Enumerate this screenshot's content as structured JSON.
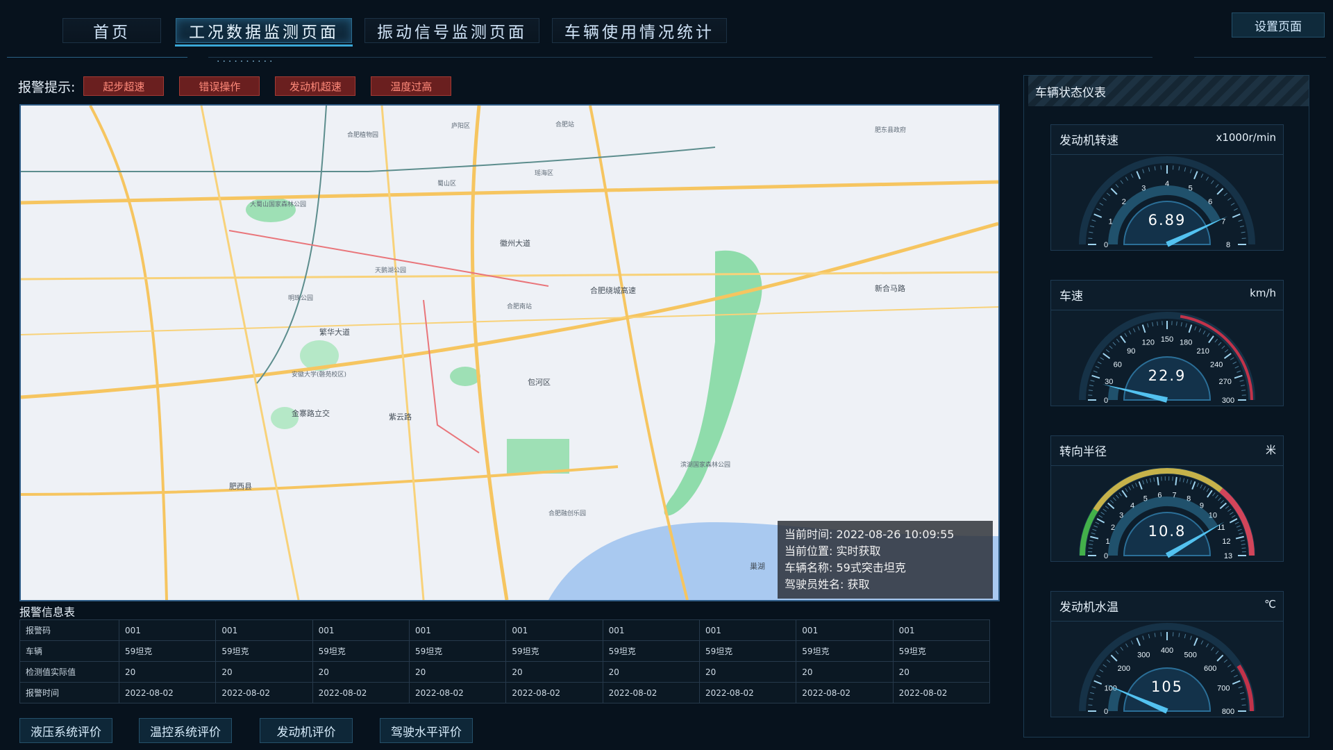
{
  "nav": {
    "tabs": [
      "首页",
      "工况数据监测页面",
      "振动信号监测页面",
      "车辆使用情况统计"
    ],
    "active_index": 1,
    "settings_label": "设置页面"
  },
  "alarm": {
    "label": "报警提示:",
    "tags": [
      "起步超速",
      "错误操作",
      "发动机超速",
      "温度过高"
    ]
  },
  "map": {
    "labels": [
      {
        "text": "庐阳区"
      },
      {
        "text": "瑶海区"
      },
      {
        "text": "蜀山区"
      },
      {
        "text": "繁华大道"
      },
      {
        "text": "金寨路立交"
      },
      {
        "text": "紫云路"
      },
      {
        "text": "合肥绕城高速"
      },
      {
        "text": "徽州大道"
      },
      {
        "text": "新合马路"
      },
      {
        "text": "肥西县"
      },
      {
        "text": "肥东县政府"
      },
      {
        "text": "合肥南站"
      },
      {
        "text": "安徽大学(磬苑校区)"
      },
      {
        "text": "大蜀山国家森林公园"
      },
      {
        "text": "合肥植物园"
      },
      {
        "text": "天鹅湖公园"
      },
      {
        "text": "明珠公园"
      },
      {
        "text": "合肥站"
      },
      {
        "text": "滨湖国家森林公园"
      },
      {
        "text": "合肥融创乐园"
      },
      {
        "text": "包河区"
      },
      {
        "text": "巢湖"
      }
    ],
    "info": {
      "time_label": "当前时间:",
      "time_value": "2022-08-26 10:09:55",
      "location_label": "当前位置:",
      "location_value": "实时获取",
      "vehicle_label": "车辆名称:",
      "vehicle_value": "59式突击坦克",
      "driver_label": "驾驶员姓名:",
      "driver_value": "获取"
    }
  },
  "table": {
    "title": "报警信息表",
    "rows": [
      {
        "header": "报警码",
        "cells": [
          "001",
          "001",
          "001",
          "001",
          "001",
          "001",
          "001",
          "001",
          "001"
        ]
      },
      {
        "header": "车辆",
        "cells": [
          "59坦克",
          "59坦克",
          "59坦克",
          "59坦克",
          "59坦克",
          "59坦克",
          "59坦克",
          "59坦克",
          "59坦克"
        ]
      },
      {
        "header": "检测值实际值",
        "cells": [
          "20",
          "20",
          "20",
          "20",
          "20",
          "20",
          "20",
          "20",
          "20"
        ]
      },
      {
        "header": "报警时间",
        "cells": [
          "2022-08-02",
          "2022-08-02",
          "2022-08-02",
          "2022-08-02",
          "2022-08-02",
          "2022-08-02",
          "2022-08-02",
          "2022-08-02",
          "2022-08-02"
        ]
      }
    ]
  },
  "buttons": [
    "液压系统评价",
    "温控系统评价",
    "发动机评价",
    "驾驶水平评价"
  ],
  "panel": {
    "title": "车辆状态仪表",
    "gauges": [
      {
        "title": "发动机转速",
        "unit": "x1000r/min",
        "value": 6.89,
        "display": "6.89",
        "min": 0,
        "max": 8,
        "ticks": [
          "0",
          "1",
          "2",
          "3",
          "4",
          "5",
          "6",
          "7",
          "8"
        ],
        "style": "blue"
      },
      {
        "title": "车速",
        "unit": "km/h",
        "value": 22.9,
        "display": "22.9",
        "min": 0,
        "max": 300,
        "ticks": [
          "0",
          "30",
          "60",
          "90",
          "120",
          "150",
          "180",
          "210",
          "240",
          "270",
          "300"
        ],
        "style": "red"
      },
      {
        "title": "转向半径",
        "unit": "米",
        "value": 10.8,
        "display": "10.8",
        "min": 0,
        "max": 13,
        "ticks": [
          "0",
          "1",
          "2",
          "3",
          "4",
          "5",
          "6",
          "7",
          "8",
          "9",
          "10",
          "11",
          "12",
          "13"
        ],
        "style": "traffic"
      },
      {
        "title": "发动机水温",
        "unit": "℃",
        "value": 105,
        "display": "105",
        "min": 0,
        "max": 800,
        "ticks": [
          "0",
          "100",
          "200",
          "300",
          "400",
          "500",
          "600",
          "700",
          "800"
        ],
        "style": "blue-red"
      }
    ]
  },
  "colors": {
    "accent": "#3aa7d6",
    "alarm_tag_bg": "#6a1f1f",
    "alarm_tag_text": "#ff8a7a",
    "map_water": "#a9c9f0",
    "map_green": "#7fd8a2",
    "map_road_major": "#f6c560"
  }
}
